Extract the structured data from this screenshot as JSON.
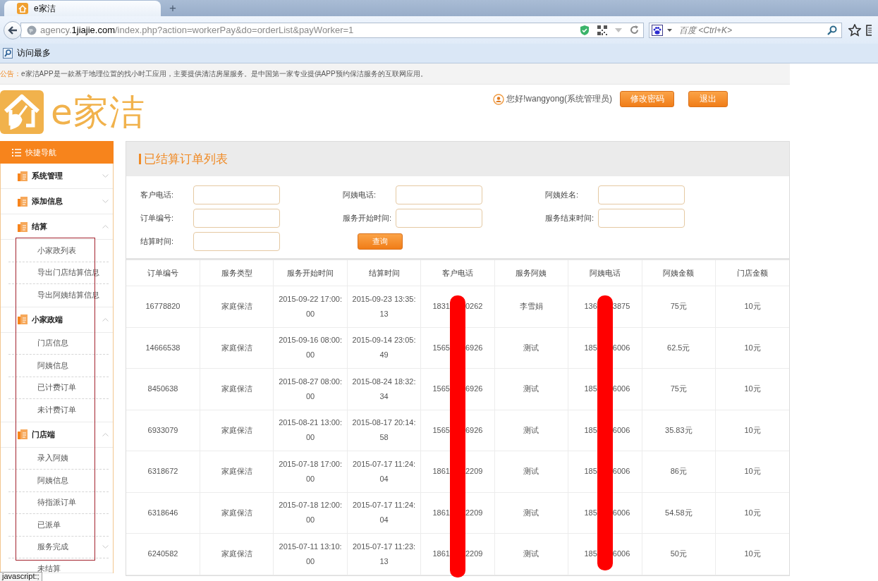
{
  "browser": {
    "tab_title": "e家洁",
    "new_tab": "+",
    "url": {
      "host_prefix": "agency.",
      "host": "1jiajie.com",
      "path": "/index.php?action=workerPay&do=orderList&payWorker=1"
    },
    "search": {
      "placeholder": "百度 <Ctrl+K>"
    },
    "bookmarks": [
      "访问最多"
    ]
  },
  "notice": {
    "label": "公告：",
    "text": "e家洁APP是一款基于地理位置的找小时工应用，主要提供清洁房屋服务。是中国第一家专业提供APP预约保洁服务的互联网应用。"
  },
  "logo": {
    "text": "e家洁"
  },
  "user": {
    "greeting": "您好!wangyong(系统管理员)",
    "buttons": [
      "修改密码",
      "退出"
    ]
  },
  "sidebar": {
    "title": "快捷导航",
    "groups": [
      {
        "label": "系统管理",
        "expanded": false
      },
      {
        "label": "添加信息",
        "expanded": false
      },
      {
        "label": "结算",
        "expanded": true,
        "children": [
          {
            "label": "小家政列表",
            "kind": "link"
          },
          {
            "label": "导出门店结算信息",
            "kind": "link"
          },
          {
            "label": "导出阿姨结算信息",
            "kind": "link"
          }
        ]
      },
      {
        "label": "小家政端",
        "expanded": true,
        "children": [
          {
            "label": "门店信息",
            "kind": "link"
          },
          {
            "label": "阿姨信息",
            "kind": "link"
          },
          {
            "label": "已计费订单",
            "kind": "link"
          },
          {
            "label": "未计费订单",
            "kind": "link"
          }
        ]
      },
      {
        "label": "门店端",
        "expanded": true,
        "children": [
          {
            "label": "录入阿姨",
            "kind": "link"
          },
          {
            "label": "阿姨信息",
            "kind": "link"
          },
          {
            "label": "待指派订单",
            "kind": "link"
          },
          {
            "label": "已派单",
            "kind": "link"
          },
          {
            "label": "服务完成",
            "kind": "folder"
          },
          {
            "label": "未结算",
            "kind": "link"
          }
        ]
      }
    ]
  },
  "panel": {
    "title": "已结算订单列表",
    "filters": [
      {
        "label": "客户电话:"
      },
      {
        "label": "阿姨电话:"
      },
      {
        "label": "阿姨姓名:"
      },
      {
        "label": "订单编号:"
      },
      {
        "label": "服务开始时间:"
      },
      {
        "label": "服务结束时间:"
      },
      {
        "label": "结算时间:"
      }
    ],
    "search_button": "查询"
  },
  "table": {
    "columns": [
      "订单编号",
      "服务类型",
      "服务开始时间",
      "结算时间",
      "客户电话",
      "服务阿姨",
      "阿姨电话",
      "阿姨金额",
      "门店金额"
    ],
    "rows": [
      {
        "order_no": "16778820",
        "service_type": "家庭保洁",
        "start_time": "2015-09-22 17:00:00",
        "settle_time": "2015-09-23 13:35:13",
        "customer_phone": {
          "head": "1831",
          "tail": "0262"
        },
        "worker": "李雪娟",
        "worker_phone": {
          "head": "136",
          "tail": "3875"
        },
        "worker_amount": "75元",
        "store_amount": "10元"
      },
      {
        "order_no": "14666538",
        "service_type": "家庭保洁",
        "start_time": "2015-09-16 08:00:00",
        "settle_time": "2015-09-14 23:05:49",
        "customer_phone": {
          "head": "1565",
          "tail": "6926"
        },
        "worker": "测试",
        "worker_phone": {
          "head": "185",
          "tail": "6006"
        },
        "worker_amount": "62.5元",
        "store_amount": "10元"
      },
      {
        "order_no": "8450638",
        "service_type": "家庭保洁",
        "start_time": "2015-08-27 08:00:00",
        "settle_time": "2015-08-24 18:32:34",
        "customer_phone": {
          "head": "1565",
          "tail": "6926"
        },
        "worker": "测试",
        "worker_phone": {
          "head": "185",
          "tail": "6006"
        },
        "worker_amount": "75元",
        "store_amount": "10元"
      },
      {
        "order_no": "6933079",
        "service_type": "家庭保洁",
        "start_time": "2015-08-21 13:00:00",
        "settle_time": "2015-08-17 20:14:58",
        "customer_phone": {
          "head": "1565",
          "tail": "6926"
        },
        "worker": "测试",
        "worker_phone": {
          "head": "185",
          "tail": "6006"
        },
        "worker_amount": "35.83元",
        "store_amount": "10元"
      },
      {
        "order_no": "6318672",
        "service_type": "家庭保洁",
        "start_time": "2015-07-18 17:00:00",
        "settle_time": "2015-07-17 11:24:04",
        "customer_phone": {
          "head": "1861",
          "tail": "2209"
        },
        "worker": "测试",
        "worker_phone": {
          "head": "185",
          "tail": "6006"
        },
        "worker_amount": "86元",
        "store_amount": "10元"
      },
      {
        "order_no": "6318646",
        "service_type": "家庭保洁",
        "start_time": "2015-07-18 12:00:00",
        "settle_time": "2015-07-17 11:24:04",
        "customer_phone": {
          "head": "1861",
          "tail": "2209"
        },
        "worker": "测试",
        "worker_phone": {
          "head": "185",
          "tail": "6006"
        },
        "worker_amount": "54.58元",
        "store_amount": "10元"
      },
      {
        "order_no": "6240582",
        "service_type": "家庭保洁",
        "start_time": "2015-07-11 13:10:00",
        "settle_time": "2015-07-17 11:23:13",
        "customer_phone": {
          "head": "1861",
          "tail": "2209"
        },
        "worker": "测试",
        "worker_phone": {
          "head": "185",
          "tail": "6006"
        },
        "worker_amount": "50元",
        "store_amount": "10元"
      }
    ]
  },
  "status_tip": "javascript:;"
}
